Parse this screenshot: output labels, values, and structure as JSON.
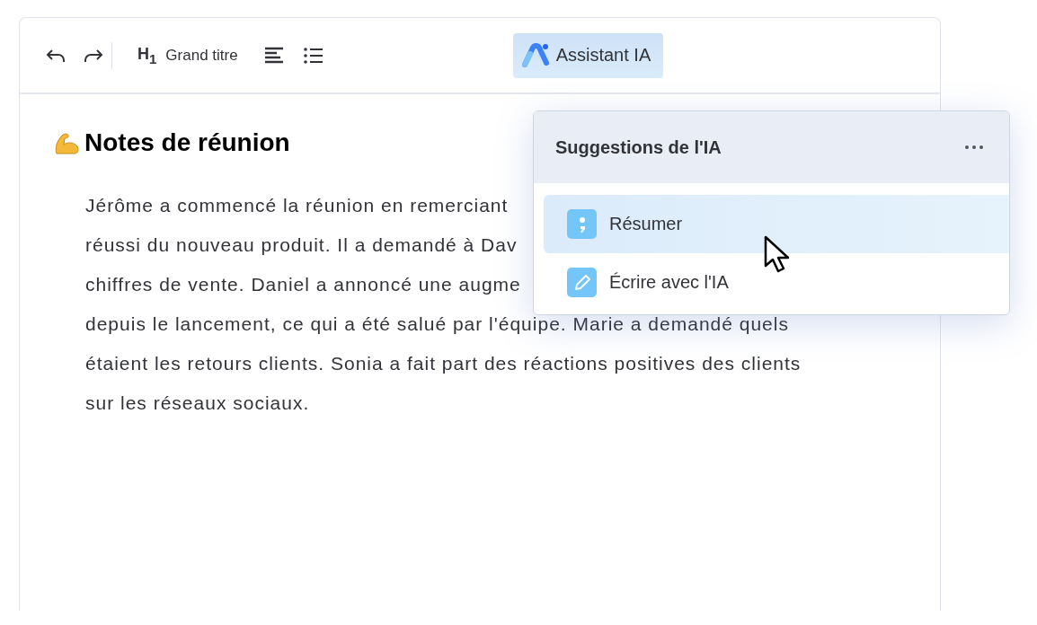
{
  "toolbar": {
    "heading_mark": "H$_{1}$",
    "heading_style": "Grand titre",
    "assistant_button": "Assistant IA"
  },
  "document": {
    "title": "Notes de réunion",
    "lines": [
      "Jérôme a commencé la réunion en remerciant",
      "réussi du nouveau produit. Il a demandé à Dav",
      "chiffres de vente. Daniel a annoncé une augme",
      "depuis le lancement, ce qui a été salué par l'équipe. Marie a demandé quels",
      "étaient les retours clients. Sonia a fait part des réactions positives des clients",
      "sur les réseaux sociaux."
    ]
  },
  "ai_panel": {
    "title": "Suggestions de l'IA",
    "items": [
      {
        "kind": "summarize",
        "label": "Résumer",
        "selected": true
      },
      {
        "kind": "write",
        "label": "Écrire avec l'IA",
        "selected": false
      }
    ]
  }
}
